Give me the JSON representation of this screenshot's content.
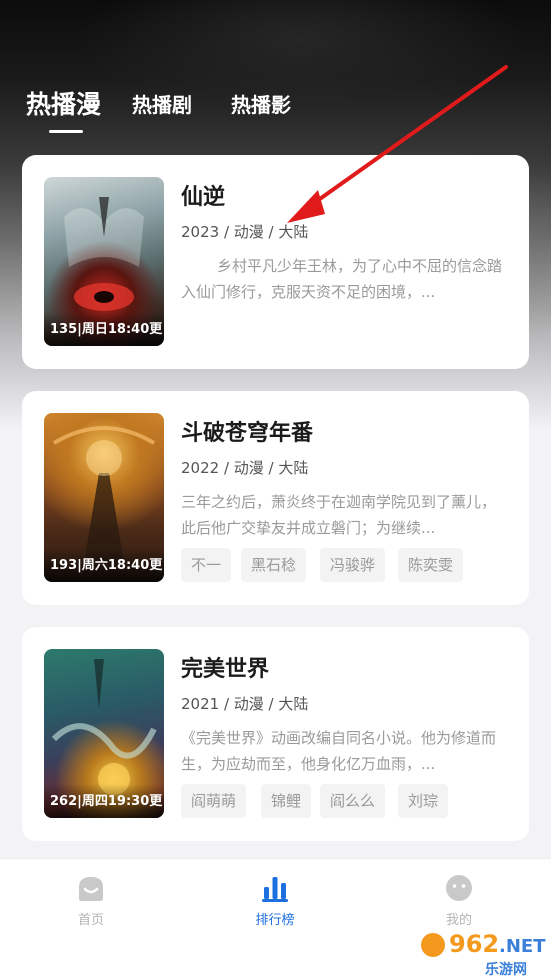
{
  "tabs": [
    {
      "label": "热播漫",
      "active": true
    },
    {
      "label": "热播剧",
      "active": false
    },
    {
      "label": "热播影",
      "active": false
    }
  ],
  "cards": [
    {
      "title": "仙逆",
      "meta": "2023 / 动漫 / 大陆",
      "description": "乡村平凡少年王林，为了心中不屈的信念踏入仙门修行，克服天资不足的困境，...",
      "poster_label": "135|周日18:40更",
      "tags": []
    },
    {
      "title": "斗破苍穹年番",
      "meta": "2022 / 动漫 / 大陆",
      "description": "三年之约后，萧炎终于在迦南学院见到了薰儿，此后他广交挚友并成立磐门；为继续...",
      "poster_label": "193|周六18:40更",
      "tags": [
        "不一",
        "黑石稔",
        "冯骏骅",
        "陈奕雯"
      ]
    },
    {
      "title": "完美世界",
      "meta": "2021 / 动漫 / 大陆",
      "description": "《完美世界》动画改编自同名小说。他为修道而生，为应劫而至，他身化亿万血雨，...",
      "poster_label": "262|周四19:30更",
      "tags": [
        "阎萌萌",
        "锦鲤",
        "阎么么",
        "刘琮"
      ]
    }
  ],
  "nav": [
    {
      "label": "首页",
      "icon": "home-icon",
      "active": false
    },
    {
      "label": "排行榜",
      "icon": "ranking-bars-icon",
      "active": true
    },
    {
      "label": "我的",
      "icon": "profile-face-icon",
      "active": false
    }
  ],
  "watermark": {
    "number": "962",
    "domain": ".NET",
    "site": "乐游网"
  },
  "colors": {
    "accent": "#1e6fe0",
    "arrow": "#e11b1b",
    "card": "#ffffff",
    "muted": "#9a9a9a"
  }
}
